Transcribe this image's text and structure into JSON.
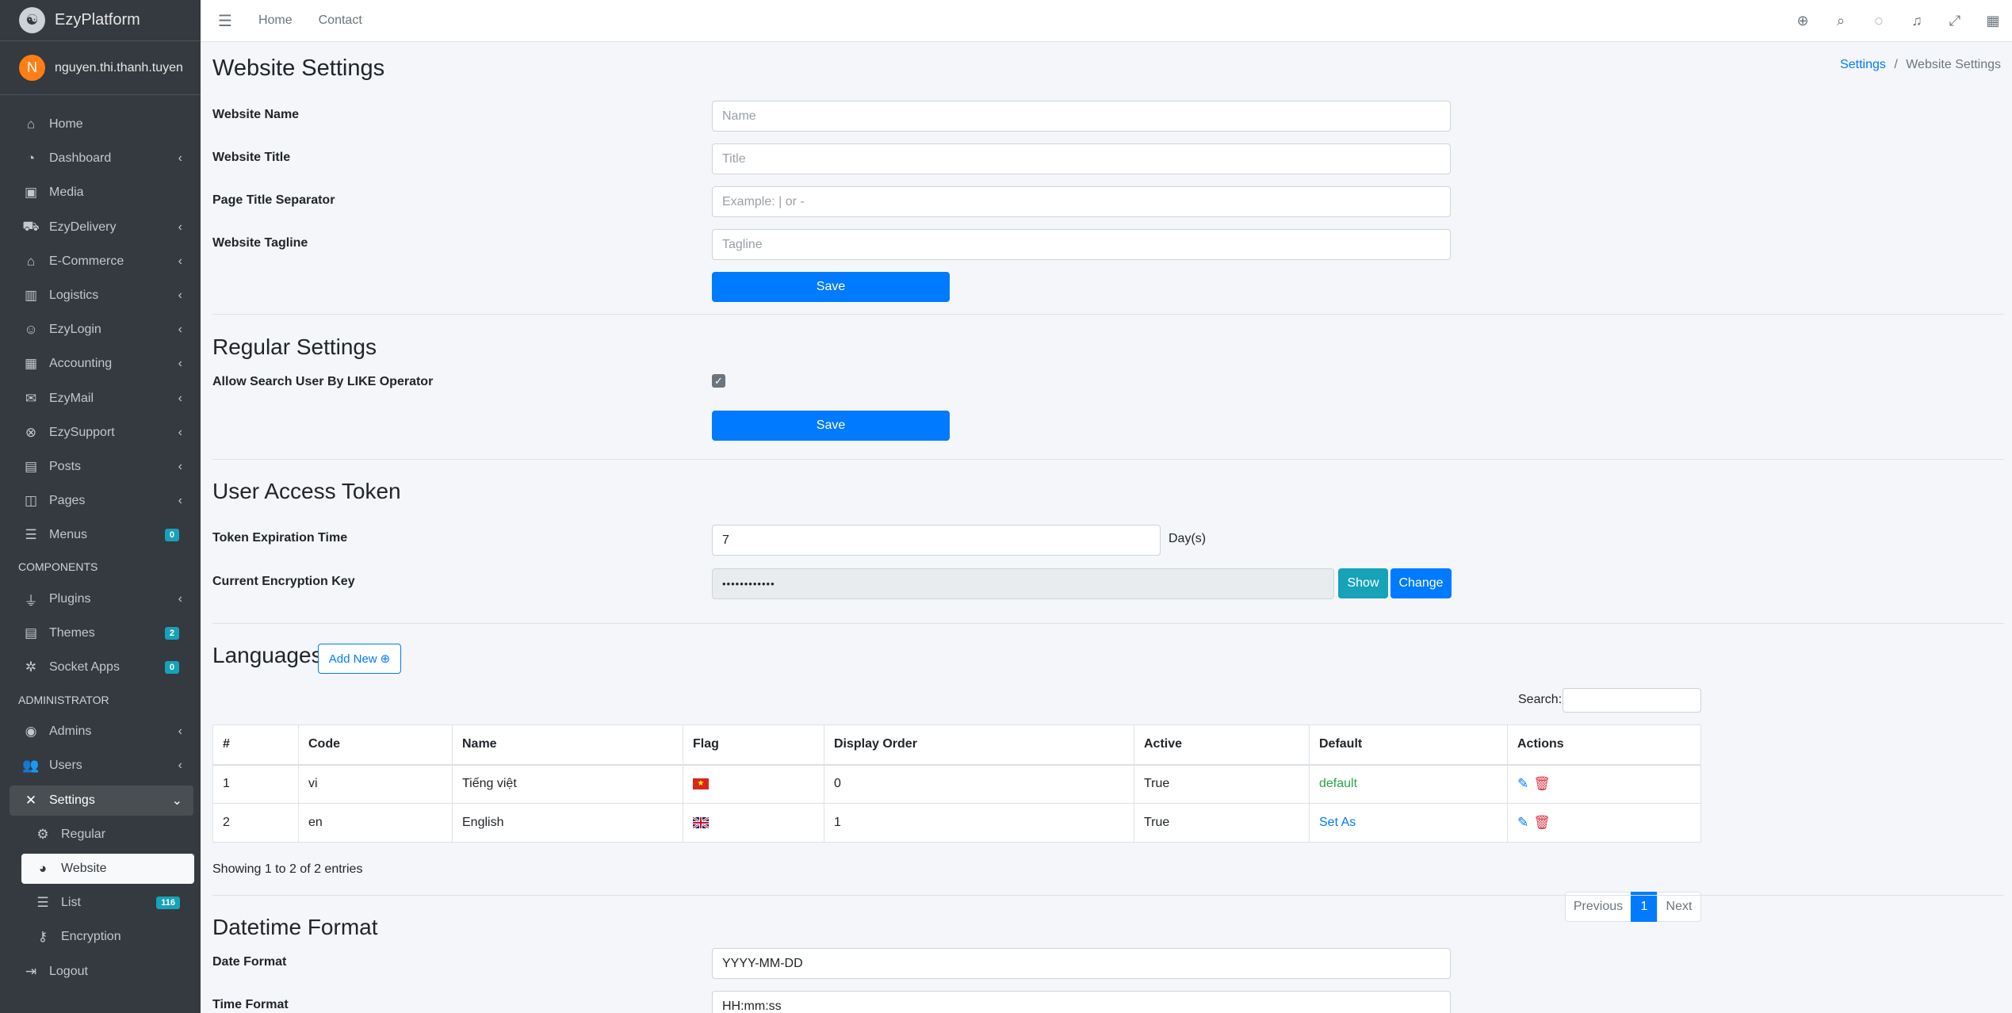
{
  "brand": {
    "name": "EzyPlatform"
  },
  "user": {
    "initial": "N",
    "name": "nguyen.thi.thanh.tuyen"
  },
  "sidebar": {
    "items": [
      {
        "label": "Home",
        "icon": "home-icon"
      },
      {
        "label": "Dashboard",
        "icon": "dashboard-icon"
      },
      {
        "label": "Media",
        "icon": "image-icon"
      },
      {
        "label": "EzyDelivery",
        "icon": "truck-icon"
      },
      {
        "label": "E-Commerce",
        "icon": "shop-icon"
      },
      {
        "label": "Logistics",
        "icon": "pallet-icon"
      },
      {
        "label": "EzyLogin",
        "icon": "user-lock-icon"
      },
      {
        "label": "Accounting",
        "icon": "calculator-icon"
      },
      {
        "label": "EzyMail",
        "icon": "envelope-icon"
      },
      {
        "label": "EzySupport",
        "icon": "support-icon"
      },
      {
        "label": "Posts",
        "icon": "posts-icon"
      },
      {
        "label": "Pages",
        "icon": "book-icon"
      },
      {
        "label": "Menus",
        "icon": "bars-icon",
        "badge": "0"
      }
    ],
    "components_header": "COMPONENTS",
    "components": [
      {
        "label": "Plugins",
        "icon": "plug-icon"
      },
      {
        "label": "Themes",
        "icon": "themes-icon",
        "badge": "2"
      },
      {
        "label": "Socket Apps",
        "icon": "socket-icon",
        "badge": "0"
      }
    ],
    "admin_header": "ADMINISTRATOR",
    "admin": [
      {
        "label": "Admins",
        "icon": "user-circle-icon"
      },
      {
        "label": "Users",
        "icon": "users-icon"
      },
      {
        "label": "Settings",
        "icon": "tools-icon"
      }
    ],
    "settings_sub": [
      {
        "label": "Regular",
        "icon": "cogs-icon"
      },
      {
        "label": "Website",
        "icon": "globe-icon"
      },
      {
        "label": "List",
        "icon": "list-icon",
        "badge": "116"
      },
      {
        "label": "Encryption",
        "icon": "key-icon"
      }
    ],
    "logout": "Logout"
  },
  "topbar": {
    "links": [
      "Home",
      "Contact"
    ],
    "icons": [
      "globe-icon",
      "search-icon",
      "comments-icon",
      "bell-icon",
      "expand-icon",
      "grid-icon"
    ]
  },
  "breadcrumb": {
    "parent": "Settings",
    "separator": "/",
    "current": "Website Settings"
  },
  "website_settings": {
    "title": "Website Settings",
    "name_label": "Website Name",
    "name_placeholder": "Name",
    "title_label": "Website Title",
    "title_placeholder": "Title",
    "separator_label": "Page Title Separator",
    "separator_placeholder": "Example: | or -",
    "tagline_label": "Website Tagline",
    "tagline_placeholder": "Tagline",
    "save": "Save"
  },
  "regular_settings": {
    "title": "Regular Settings",
    "like_label": "Allow Search User By LIKE Operator",
    "like_checked": true,
    "save": "Save"
  },
  "access_token": {
    "title": "User Access Token",
    "expiration_label": "Token Expiration Time",
    "expiration_value": "7",
    "expiration_unit": "Day(s)",
    "key_label": "Current Encryption Key",
    "key_value": "••••••••••••",
    "show": "Show",
    "change": "Change"
  },
  "languages": {
    "title": "Languages",
    "add_new": "Add New",
    "search_label": "Search:",
    "columns": [
      "#",
      "Code",
      "Name",
      "Flag",
      "Display Order",
      "Active",
      "Default",
      "Actions"
    ],
    "rows": [
      {
        "num": "1",
        "code": "vi",
        "name": "Tiếng việt",
        "flag": "vn",
        "order": "0",
        "active": "True",
        "default": "default",
        "default_color": "#28a745"
      },
      {
        "num": "2",
        "code": "en",
        "name": "English",
        "flag": "gb",
        "order": "1",
        "active": "True",
        "default": "Set As",
        "default_color": "#007bff"
      }
    ],
    "info": "Showing 1 to 2 of 2 entries",
    "pagination": {
      "previous": "Previous",
      "page": "1",
      "next": "Next"
    }
  },
  "datetime": {
    "title": "Datetime Format",
    "date_label": "Date Format",
    "date_value": "YYYY-MM-DD",
    "time_label": "Time Format",
    "time_value": "HH:mm:ss"
  },
  "colors": {
    "primary": "#007bff",
    "info": "#17a2b8",
    "danger": "#dc3545",
    "success": "#28a745",
    "sidebar": "#343a40"
  }
}
